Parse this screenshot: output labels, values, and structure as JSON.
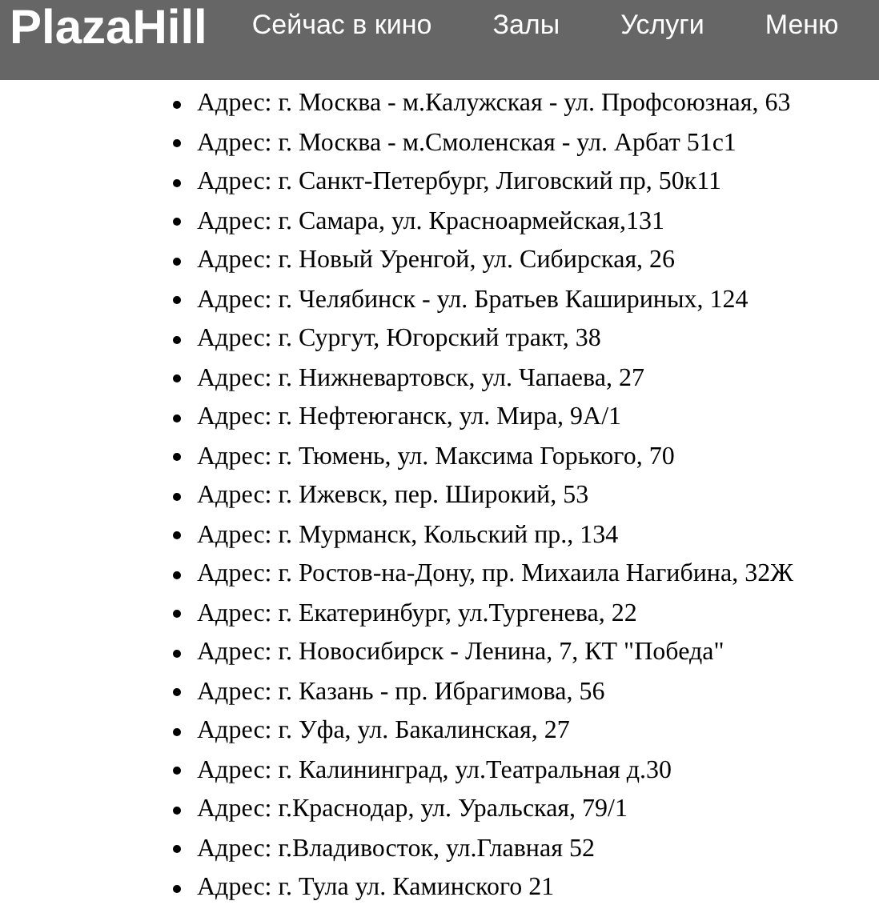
{
  "header": {
    "logo": "PlazaHill",
    "nav": [
      "Сейчас в кино",
      "Залы",
      "Услуги",
      "Меню"
    ]
  },
  "addresses": [
    "Адрес: г. Москва - м.Калужская - ул. Профсоюзная, 63",
    "Адрес: г. Москва - м.Смоленская - ул. Арбат 51с1",
    "Адрес: г. Санкт-Петербург, Лиговский пр, 50к11",
    "Адрес: г. Самара, ул. Красноармейская,131",
    "Адрес: г. Новый Уренгой, ул. Сибирская, 26",
    "Адрес: г. Челябинск - ул. Братьев Кашириных, 124",
    "Адрес: г. Сургут, Югорский тракт, 38",
    "Адрес: г. Нижневартовск, ул. Чапаева, 27",
    "Адрес: г. Нефтеюганск, ул. Мира, 9А/1",
    "Адрес: г. Тюмень, ул. Максима Горького, 70",
    "Адрес: г. Ижевск, пер. Широкий, 53",
    "Адрес: г. Мурманск, Кольский пр., 134",
    "Адрес: г. Ростов-на-Дону, пр. Михаила Нагибина, 32Ж",
    "Адрес: г. Екатеринбург, ул.Тургенева, 22",
    "Адрес: г. Новосибирск - Ленина, 7, КТ \"Победа\"",
    "Адрес: г. Казань - пр. Ибрагимова, 56",
    "Адрес: г. Уфа, ул. Бакалинская, 27",
    "Адрес: г. Калининград, ул.Театральная д.30",
    "Адрес: г.Краснодар, ул. Уральская, 79/1",
    "Адрес: г.Владивосток, ул.Главная 52",
    "Адрес: г. Тула ул. Каминского 21"
  ]
}
